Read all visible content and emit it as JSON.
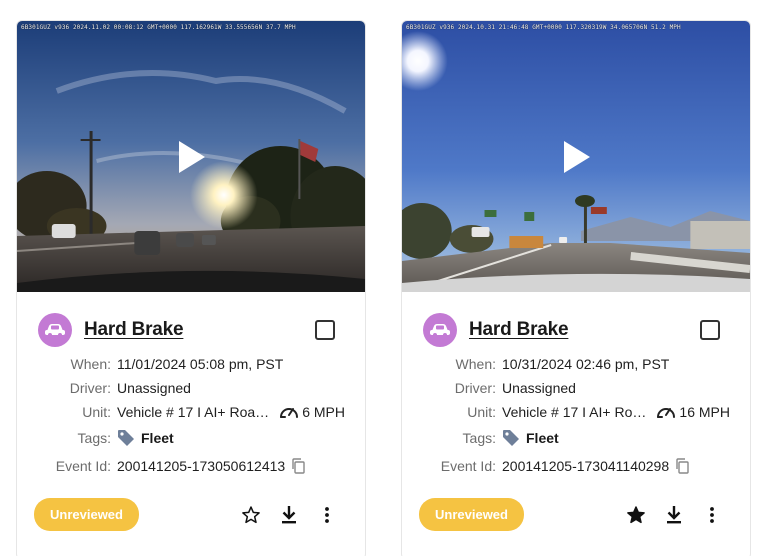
{
  "events": [
    {
      "overlay": "6B301GUZ v936 2024.11.02 00:08:12 GMT+0000 117.162961W 33.555656N 37.7 MPH",
      "title": "Hard Brake",
      "when_label": "When:",
      "when": "11/01/2024 05:08 pm, PST",
      "driver_label": "Driver:",
      "driver": "Unassigned",
      "unit_label": "Unit:",
      "unit": "Vehicle # 17 I AI+ Road ...",
      "speed": "6 MPH",
      "tags_label": "Tags:",
      "tag": "Fleet",
      "event_id_label": "Event Id:",
      "event_id": "200141205-173050612413",
      "status": "Unreviewed",
      "starred": false
    },
    {
      "overlay": "6B301GUZ v936 2024.10.31 21:46:48 GMT+0000 117.320319W 34.065706N 51.2 MPH",
      "title": "Hard Brake",
      "when_label": "When:",
      "when": "10/31/2024 02:46 pm, PST",
      "driver_label": "Driver:",
      "driver": "Unassigned",
      "unit_label": "Unit:",
      "unit": "Vehicle # 17 I AI+ Road ...",
      "speed": "16 MPH",
      "tags_label": "Tags:",
      "tag": "Fleet",
      "event_id_label": "Event Id:",
      "event_id": "200141205-173041140298",
      "status": "Unreviewed",
      "starred": true
    }
  ],
  "colors": {
    "event_icon_bg": "#c37ad4",
    "badge_bg": "#f5c342",
    "tag_icon": "#6e7f99"
  },
  "icons": {
    "event": "car-crash-icon",
    "play": "play-icon",
    "checkbox": "checkbox-icon",
    "speed": "speedometer-icon",
    "tag": "tag-icon",
    "copy": "copy-icon",
    "star": "star-icon",
    "download": "download-icon",
    "more": "more-vertical-icon"
  }
}
